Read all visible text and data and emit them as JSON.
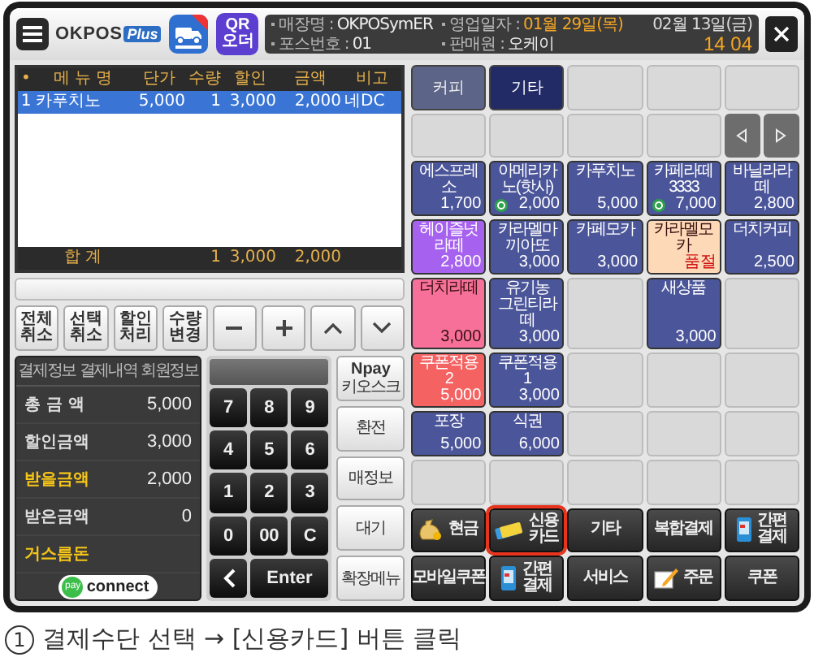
{
  "topbar": {
    "logo": "OKPOS",
    "logo_badge": "Plus",
    "qr_label": "QR 오더",
    "info": [
      {
        "label": "매장명 :",
        "value": "OKPOSymER",
        "kind": "plain"
      },
      {
        "label": "영업일자 :",
        "value": "01월 29일(목)",
        "kind": "accent"
      },
      {
        "label": "포스번호 :",
        "value": "01",
        "kind": "plain"
      },
      {
        "label": "판매원 :",
        "value": "오케이",
        "kind": "plain"
      }
    ],
    "date": "02월 13일(금)",
    "time": "14 04"
  },
  "order_table": {
    "columns": [
      "•",
      "메 뉴 명",
      "단가",
      "수량",
      "할인",
      "금액",
      "비고"
    ],
    "rows": [
      {
        "cells": [
          "1",
          "카푸치노",
          "5,000",
          "1",
          "3,000",
          "2,000",
          "네DC"
        ],
        "selected": true
      }
    ],
    "totals": {
      "label": "합 계",
      "quantity": "1",
      "discount": "3,000",
      "amount": "2,000"
    }
  },
  "edit_buttons": [
    {
      "kind": "text",
      "label": "전체 취소"
    },
    {
      "kind": "text",
      "label": "선택 취소"
    },
    {
      "kind": "text",
      "label": "할인 처리"
    },
    {
      "kind": "text",
      "label": "수량 변경"
    },
    {
      "kind": "minus"
    },
    {
      "kind": "plus"
    },
    {
      "kind": "up"
    },
    {
      "kind": "down"
    }
  ],
  "payment_info": {
    "tabs": [
      "결제정보",
      "결제내역",
      "회원정보"
    ],
    "rows": [
      {
        "label": "총 금 액",
        "value": "5,000",
        "emphasis": false
      },
      {
        "label": "할인금액",
        "value": "3,000",
        "emphasis": false
      },
      {
        "label": "받을금액",
        "value": "2,000",
        "emphasis": true
      },
      {
        "label": "받은금액",
        "value": "0",
        "emphasis": false
      },
      {
        "label": "거스름돈",
        "emphasis": true
      }
    ],
    "badge_pay": "pay",
    "badge_text": "connect"
  },
  "keypad": [
    {
      "kind": "digit",
      "label": "7"
    },
    {
      "kind": "digit",
      "label": "8"
    },
    {
      "kind": "digit",
      "label": "9"
    },
    {
      "kind": "digit",
      "label": "4"
    },
    {
      "kind": "digit",
      "label": "5"
    },
    {
      "kind": "digit",
      "label": "6"
    },
    {
      "kind": "digit",
      "label": "1"
    },
    {
      "kind": "digit",
      "label": "2"
    },
    {
      "kind": "digit",
      "label": "3"
    },
    {
      "kind": "digit",
      "label": "0"
    },
    {
      "kind": "digit",
      "label": "00"
    },
    {
      "kind": "digit",
      "label": "C"
    },
    {
      "kind": "back"
    },
    {
      "kind": "enter",
      "label": "Enter"
    }
  ],
  "side_buttons": [
    {
      "label": "Npay",
      "sub": "키오스크"
    },
    {
      "label": "환전"
    },
    {
      "label": "매정보"
    },
    {
      "label": "대기"
    },
    {
      "label": "확장메뉴"
    }
  ],
  "menu_grid": [
    {
      "kind": "category",
      "label": "커피",
      "selected": false
    },
    {
      "kind": "category",
      "label": "기타",
      "selected": true
    },
    {
      "kind": "empty"
    },
    {
      "kind": "empty"
    },
    {
      "kind": "empty"
    },
    {
      "kind": "empty"
    },
    {
      "kind": "empty"
    },
    {
      "kind": "empty"
    },
    {
      "kind": "empty"
    },
    {
      "kind": "nav"
    },
    {
      "kind": "product",
      "name": "에스프레소",
      "price": "1,700",
      "color": "#4b5599",
      "badge": false,
      "sold_out": false
    },
    {
      "kind": "product",
      "name": "아메리카노(핫사)",
      "price": "2,000",
      "color": "#4b5599",
      "badge": true,
      "sold_out": false
    },
    {
      "kind": "product",
      "name": "카푸치노",
      "price": "5,000",
      "color": "#4b5599",
      "badge": false,
      "sold_out": false
    },
    {
      "kind": "product",
      "name": "카페라떼3333",
      "price": "7,000",
      "color": "#4b5599",
      "badge": true,
      "sold_out": false
    },
    {
      "kind": "product",
      "name": "바닐라라떼",
      "price": "2,800",
      "color": "#4b5599",
      "badge": false,
      "sold_out": false
    },
    {
      "kind": "product",
      "name": "헤이즐넛라떼",
      "price": "2,800",
      "color": "#a662ee",
      "badge": false,
      "sold_out": false
    },
    {
      "kind": "product",
      "name": "카라멜마끼아또",
      "price": "3,000",
      "color": "#4b5599",
      "badge": false,
      "sold_out": false
    },
    {
      "kind": "product",
      "name": "카페모카",
      "price": "3,000",
      "color": "#4b5599",
      "badge": false,
      "sold_out": false
    },
    {
      "kind": "product",
      "name": "카라멜모카",
      "price": "품절",
      "color": "#fdd9b8",
      "badge": false,
      "sold_out": true
    },
    {
      "kind": "product",
      "name": "더치커피",
      "price": "2,500",
      "color": "#4b5599",
      "badge": false,
      "sold_out": false
    },
    {
      "kind": "product",
      "name": "더치라떼",
      "price": "3,000",
      "color": "#f7709a",
      "badge": false,
      "sold_out": false
    },
    {
      "kind": "product",
      "name": "유기농 그린티라떼",
      "price": "3,000",
      "color": "#4b5599",
      "badge": false,
      "sold_out": false
    },
    {
      "kind": "empty"
    },
    {
      "kind": "product",
      "name": "새상품",
      "price": "3,000",
      "color": "#4b5599",
      "badge": false,
      "sold_out": false
    },
    {
      "kind": "empty"
    },
    {
      "kind": "product",
      "name": "쿠폰적용2",
      "price": "5,000",
      "color": "#f46262",
      "badge": false,
      "sold_out": false
    },
    {
      "kind": "product",
      "name": "쿠폰적용1",
      "price": "3,000",
      "color": "#4b5599",
      "badge": false,
      "sold_out": false
    },
    {
      "kind": "empty"
    },
    {
      "kind": "empty"
    },
    {
      "kind": "empty"
    },
    {
      "kind": "product",
      "name": "포장",
      "price": "5,000",
      "color": "#4b5599",
      "badge": false,
      "sold_out": false
    },
    {
      "kind": "product",
      "name": "식권",
      "price": "6,000",
      "color": "#4b5599",
      "badge": false,
      "sold_out": false
    },
    {
      "kind": "empty"
    },
    {
      "kind": "empty"
    },
    {
      "kind": "empty"
    },
    {
      "kind": "empty"
    },
    {
      "kind": "empty"
    },
    {
      "kind": "empty"
    },
    {
      "kind": "empty"
    },
    {
      "kind": "empty"
    }
  ],
  "payment_buttons": [
    {
      "label": "현금",
      "kind": "cash",
      "highlighted": false
    },
    {
      "label": "신용카드",
      "kind": "card",
      "highlighted": true
    },
    {
      "label": "기타",
      "kind": "plain",
      "highlighted": false
    },
    {
      "label": "복합결제",
      "kind": "plain",
      "highlighted": false
    },
    {
      "label": "간편결제",
      "kind": "mobile",
      "highlighted": false
    },
    {
      "label": "모바일쿠폰",
      "kind": "plain",
      "highlighted": false
    },
    {
      "label": "간편결제",
      "kind": "mobile",
      "highlighted": false
    },
    {
      "label": "서비스",
      "kind": "plain",
      "highlighted": false
    },
    {
      "label": "주문",
      "kind": "order",
      "highlighted": false
    },
    {
      "label": "쿠폰",
      "kind": "plain",
      "highlighted": false
    }
  ],
  "caption": {
    "step": "1",
    "text": "결제수단 선택 → [신용카드] 버튼 클릭"
  }
}
